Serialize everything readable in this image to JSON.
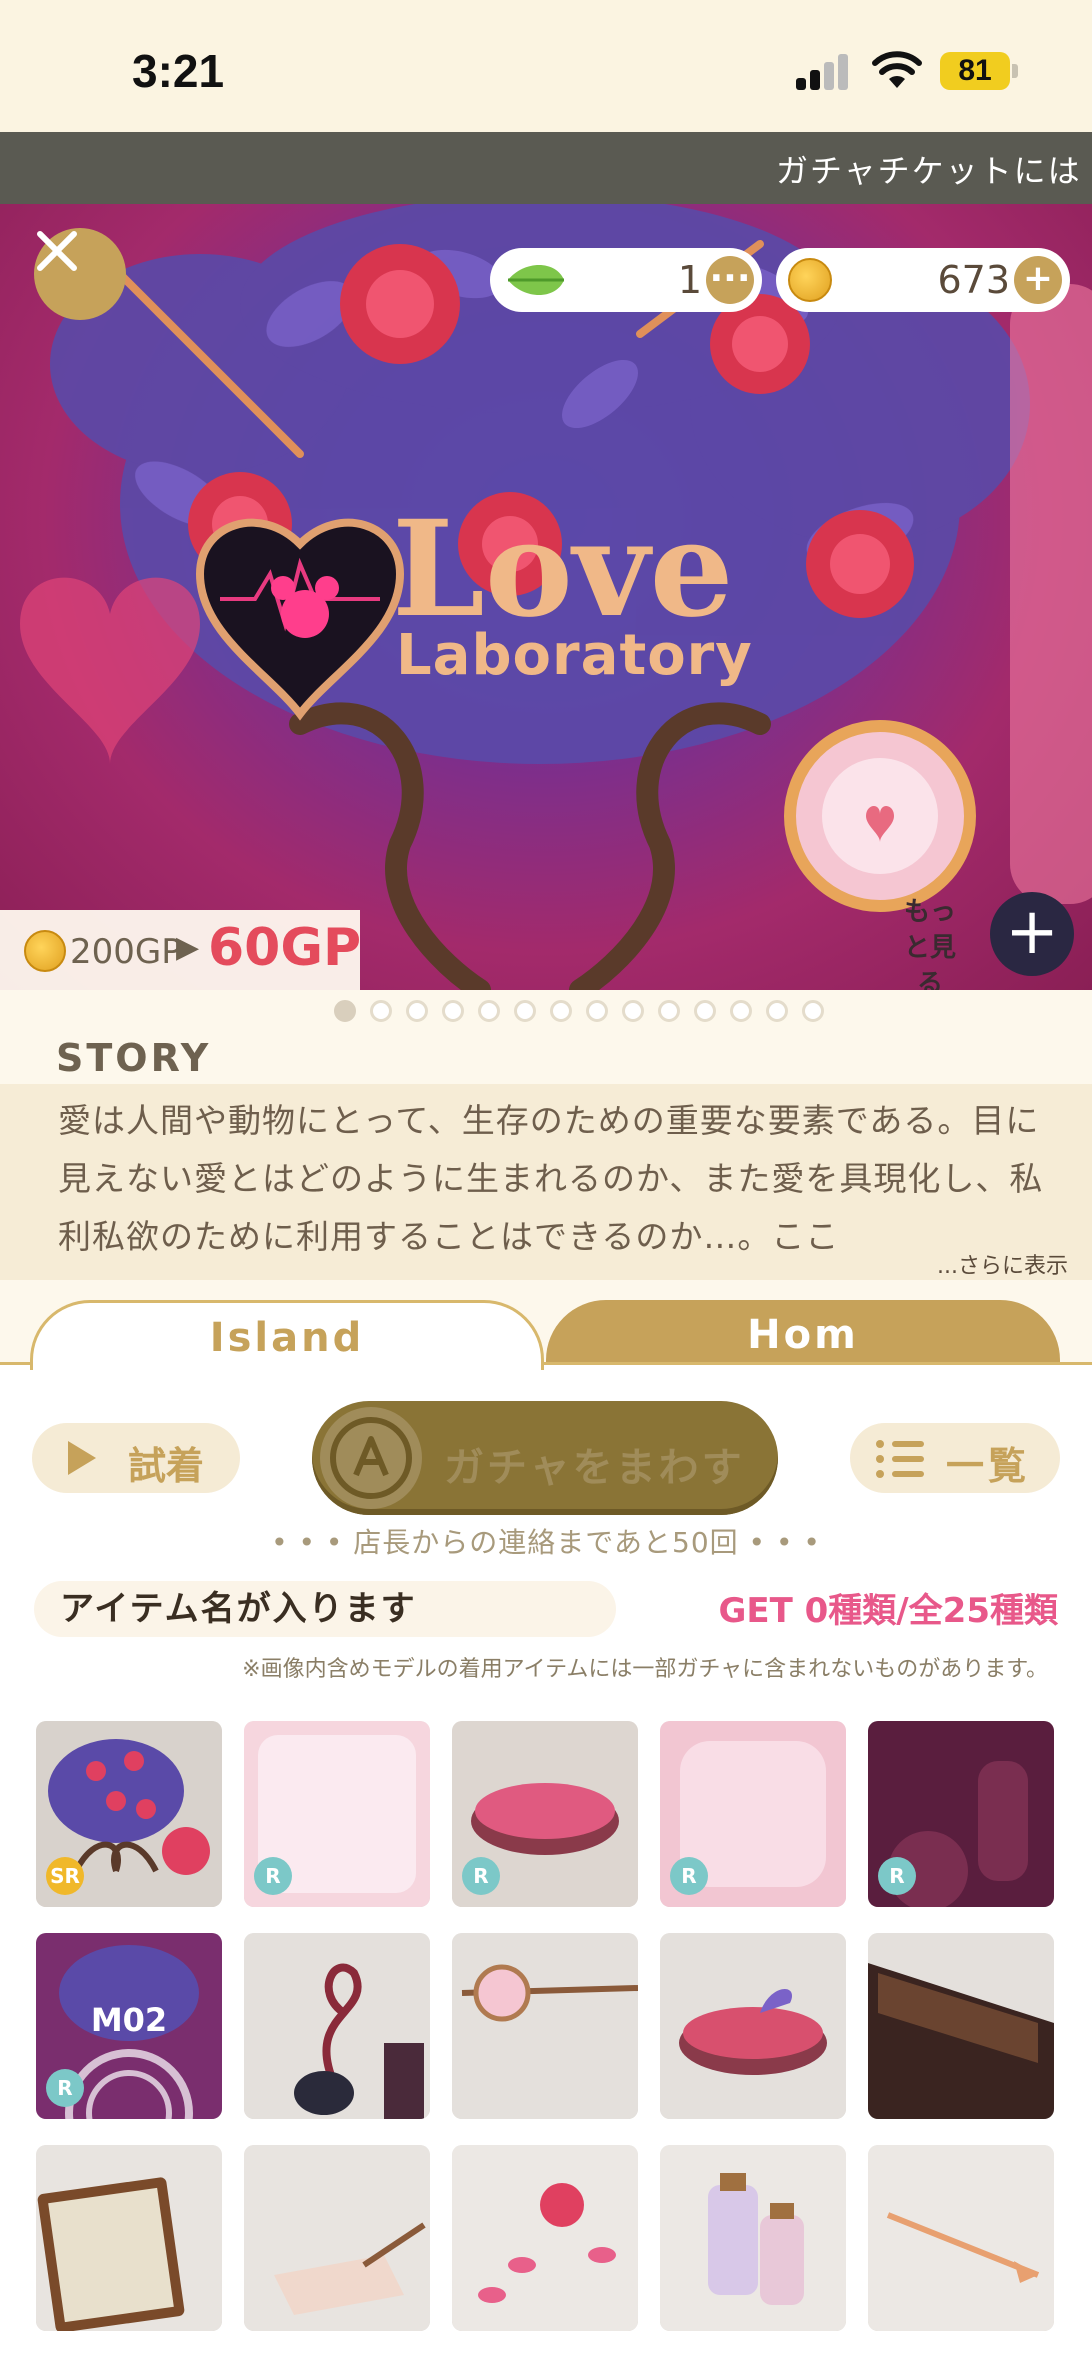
{
  "status": {
    "time": "3:21",
    "battery": "81"
  },
  "ticker": {
    "text": "ガチャチケットには"
  },
  "banner": {
    "leaf_count": "1",
    "coin_count": "673",
    "more_label": "もっと見る",
    "price_old": "200GP",
    "price_arrow": "▶",
    "price_new": "60GP",
    "page_count": 14,
    "active_page": 0,
    "logo_title": "Love",
    "logo_subtitle": "Laboratory"
  },
  "story": {
    "title": "STORY",
    "text": "愛は人間や動物にとって、生存のための重要な要素である。目に見えない愛とはどのように生まれるのか、また愛を具現化し、私利私欲のために利用することはできるのか…。ここ",
    "more": "...さらに表示"
  },
  "tabs": {
    "island": "Island",
    "home": "Hom"
  },
  "actions": {
    "try_on": "試着",
    "spin": "ガチャをまわす",
    "list": "一覧"
  },
  "contact_note": "• • • 店長からの連絡まであと50回 • • •",
  "item_name": "アイテム名が入ります",
  "get_count": "GET 0種類/全25種類",
  "disclaimer": "※画像内含めモデルの着用アイテムには一部ガチャに含まれないものがあります。",
  "items": [
    {
      "rarity": "SR",
      "label": ""
    },
    {
      "rarity": "R",
      "label": ""
    },
    {
      "rarity": "R",
      "label": ""
    },
    {
      "rarity": "R",
      "label": ""
    },
    {
      "rarity": "R",
      "label": ""
    },
    {
      "rarity": "R",
      "label": "M02"
    },
    {
      "rarity": "",
      "label": ""
    },
    {
      "rarity": "",
      "label": ""
    },
    {
      "rarity": "",
      "label": ""
    },
    {
      "rarity": "",
      "label": ""
    },
    {
      "rarity": "",
      "label": ""
    },
    {
      "rarity": "",
      "label": ""
    },
    {
      "rarity": "",
      "label": ""
    },
    {
      "rarity": "",
      "label": ""
    },
    {
      "rarity": "",
      "label": ""
    }
  ],
  "colors": {
    "gold": "#c6a25a",
    "pink": "#e8588a",
    "price_red": "#e44b5c",
    "cream": "#fdf8ec"
  }
}
